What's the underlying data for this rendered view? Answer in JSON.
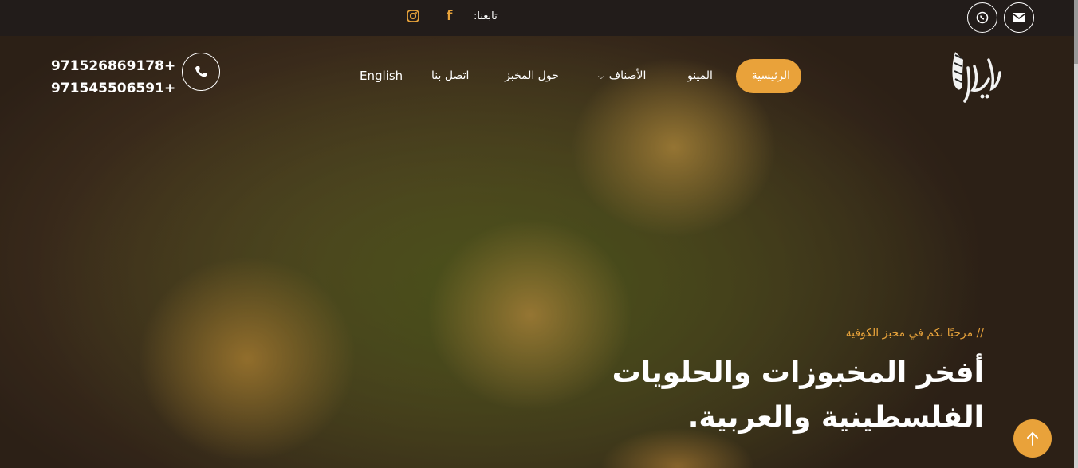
{
  "topbar": {
    "follow_label": "تابعنا:",
    "social": [
      {
        "icon": "facebook-icon",
        "glyph": "f"
      },
      {
        "icon": "instagram-icon"
      }
    ],
    "contact_buttons": [
      {
        "icon": "whatsapp-icon"
      },
      {
        "icon": "email-icon"
      }
    ]
  },
  "header": {
    "logo_alt": "الكوفية",
    "nav": {
      "home": "الرئيسية",
      "menu": "المينو",
      "categories": "الأصناف",
      "about": "حول المخبز",
      "contact": "اتصل بنا",
      "language": "English"
    },
    "phones": [
      "971526869178+",
      "971545506591+"
    ],
    "phone_icon": "phone-icon"
  },
  "hero": {
    "welcome": "// مرحبًا بكم في مخبز الكوفية",
    "headline": "أفخر المخبوزات والحلويات الفلسطينية والعربية."
  },
  "colors": {
    "accent": "#e9a23a",
    "topbar": "#221c1a",
    "text": "#ffffff"
  },
  "back_to_top_icon": "arrow-up-icon"
}
